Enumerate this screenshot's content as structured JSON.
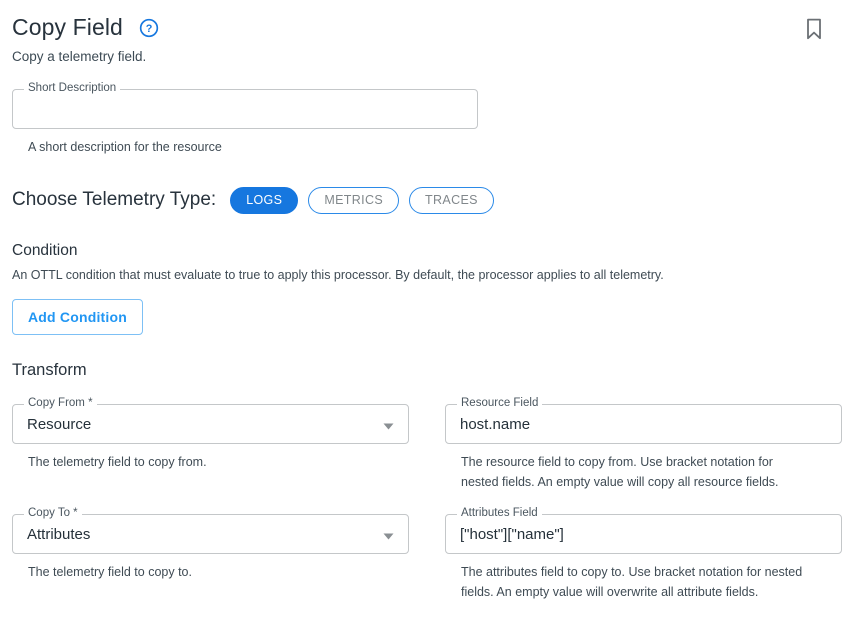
{
  "header": {
    "title": "Copy Field",
    "help_icon": "help-circle-icon",
    "bookmark_icon": "bookmark-icon",
    "subtitle": "Copy a telemetry field."
  },
  "short_description": {
    "label": "Short Description",
    "value": "",
    "placeholder": "",
    "helper": "A short description for the resource"
  },
  "telemetry": {
    "label": "Choose Telemetry Type:",
    "options": [
      {
        "label": "LOGS",
        "selected": true
      },
      {
        "label": "METRICS",
        "selected": false
      },
      {
        "label": "TRACES",
        "selected": false
      }
    ]
  },
  "condition": {
    "heading": "Condition",
    "description": "An OTTL condition that must evaluate to true to apply this processor. By default, the processor applies to all telemetry.",
    "add_button": "Add Condition"
  },
  "transform": {
    "heading": "Transform",
    "copy_from": {
      "label": "Copy From *",
      "value": "Resource",
      "helper": "The telemetry field to copy from.",
      "arrow_icon": "chevron-down-icon"
    },
    "resource_field": {
      "label": "Resource Field",
      "value": "host.name",
      "helper": "The resource field to copy from. Use bracket notation for nested fields. An empty value will copy all resource fields."
    },
    "copy_to": {
      "label": "Copy To *",
      "value": "Attributes",
      "helper": "The telemetry field to copy to.",
      "arrow_icon": "chevron-down-icon"
    },
    "attributes_field": {
      "label": "Attributes Field",
      "value": "[\"host\"][\"name\"]",
      "helper": "The attributes field to copy to. Use bracket notation for nested fields. An empty value will overwrite all attribute fields."
    }
  },
  "colors": {
    "accent_blue": "#1677df",
    "link_blue": "#2196f3",
    "pill_border": "#2b8ae8",
    "text_dark": "#28333d",
    "field_border": "#c4c7c9",
    "icon_gray": "#6b7075"
  }
}
